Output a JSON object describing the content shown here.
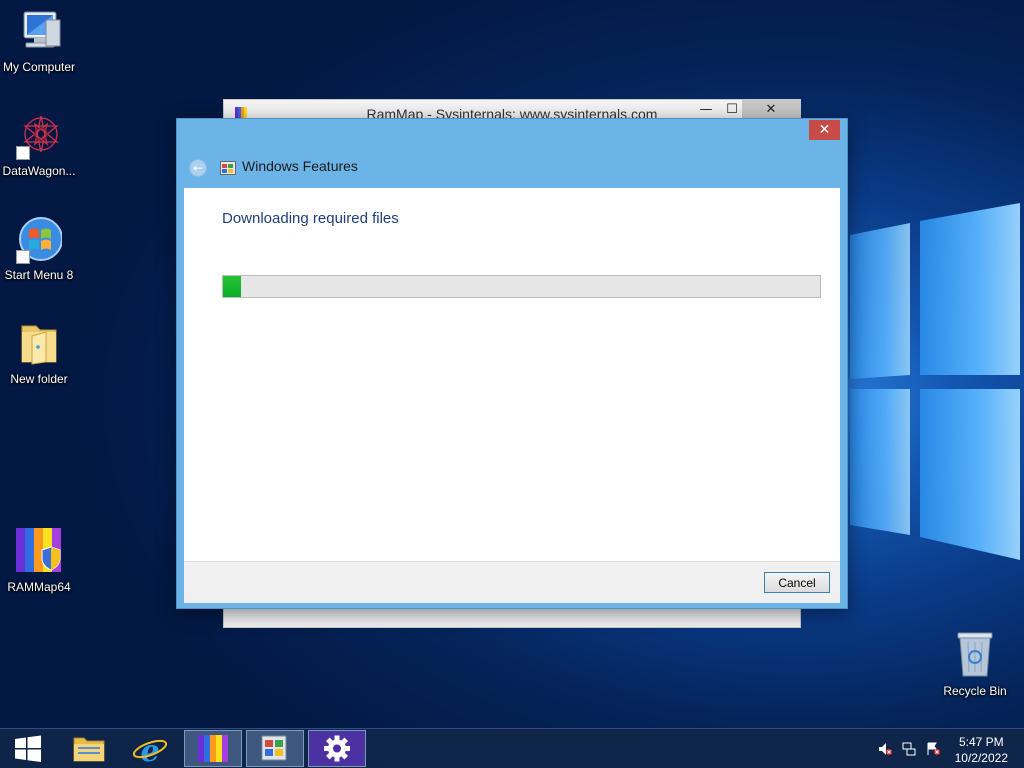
{
  "desktop_icons": [
    {
      "label": "My Computer",
      "icon": "computer-icon"
    },
    {
      "label": "DataWagon...",
      "icon": "datawagon-icon"
    },
    {
      "label": "Start Menu 8",
      "icon": "start-menu-8-icon"
    },
    {
      "label": "New folder",
      "icon": "folder-icon"
    },
    {
      "label": "RAMMap64",
      "icon": "rammap-icon"
    },
    {
      "label": "Recycle Bin",
      "icon": "recycle-bin-icon"
    }
  ],
  "background_window": {
    "title": "RamMap - Sysinternals: www.sysinternals.com",
    "minimize_glyph": "—",
    "maximize_glyph": "☐",
    "close_glyph": "✕"
  },
  "dialog": {
    "title": "Windows Features",
    "heading": "Downloading required files",
    "progress_percent": 3,
    "cancel_label": "Cancel",
    "close_glyph": "✕",
    "back_glyph": "←"
  },
  "taskbar": {
    "items": [
      {
        "icon": "windows-start-icon",
        "active": false
      },
      {
        "icon": "file-explorer-icon",
        "active": false
      },
      {
        "icon": "internet-explorer-icon",
        "active": false
      },
      {
        "icon": "rammap-taskbar-icon",
        "active": true
      },
      {
        "icon": "windows-features-taskbar-icon",
        "active": true
      },
      {
        "icon": "settings-gear-icon",
        "active": true
      }
    ],
    "clock_time": "5:47 PM",
    "clock_date": "10/2/2022"
  },
  "colors": {
    "dialog_frame": "#6cb4e8",
    "progress_green": "#06b025",
    "close_red": "#c74b46",
    "heading_blue": "#1e3f7a"
  }
}
